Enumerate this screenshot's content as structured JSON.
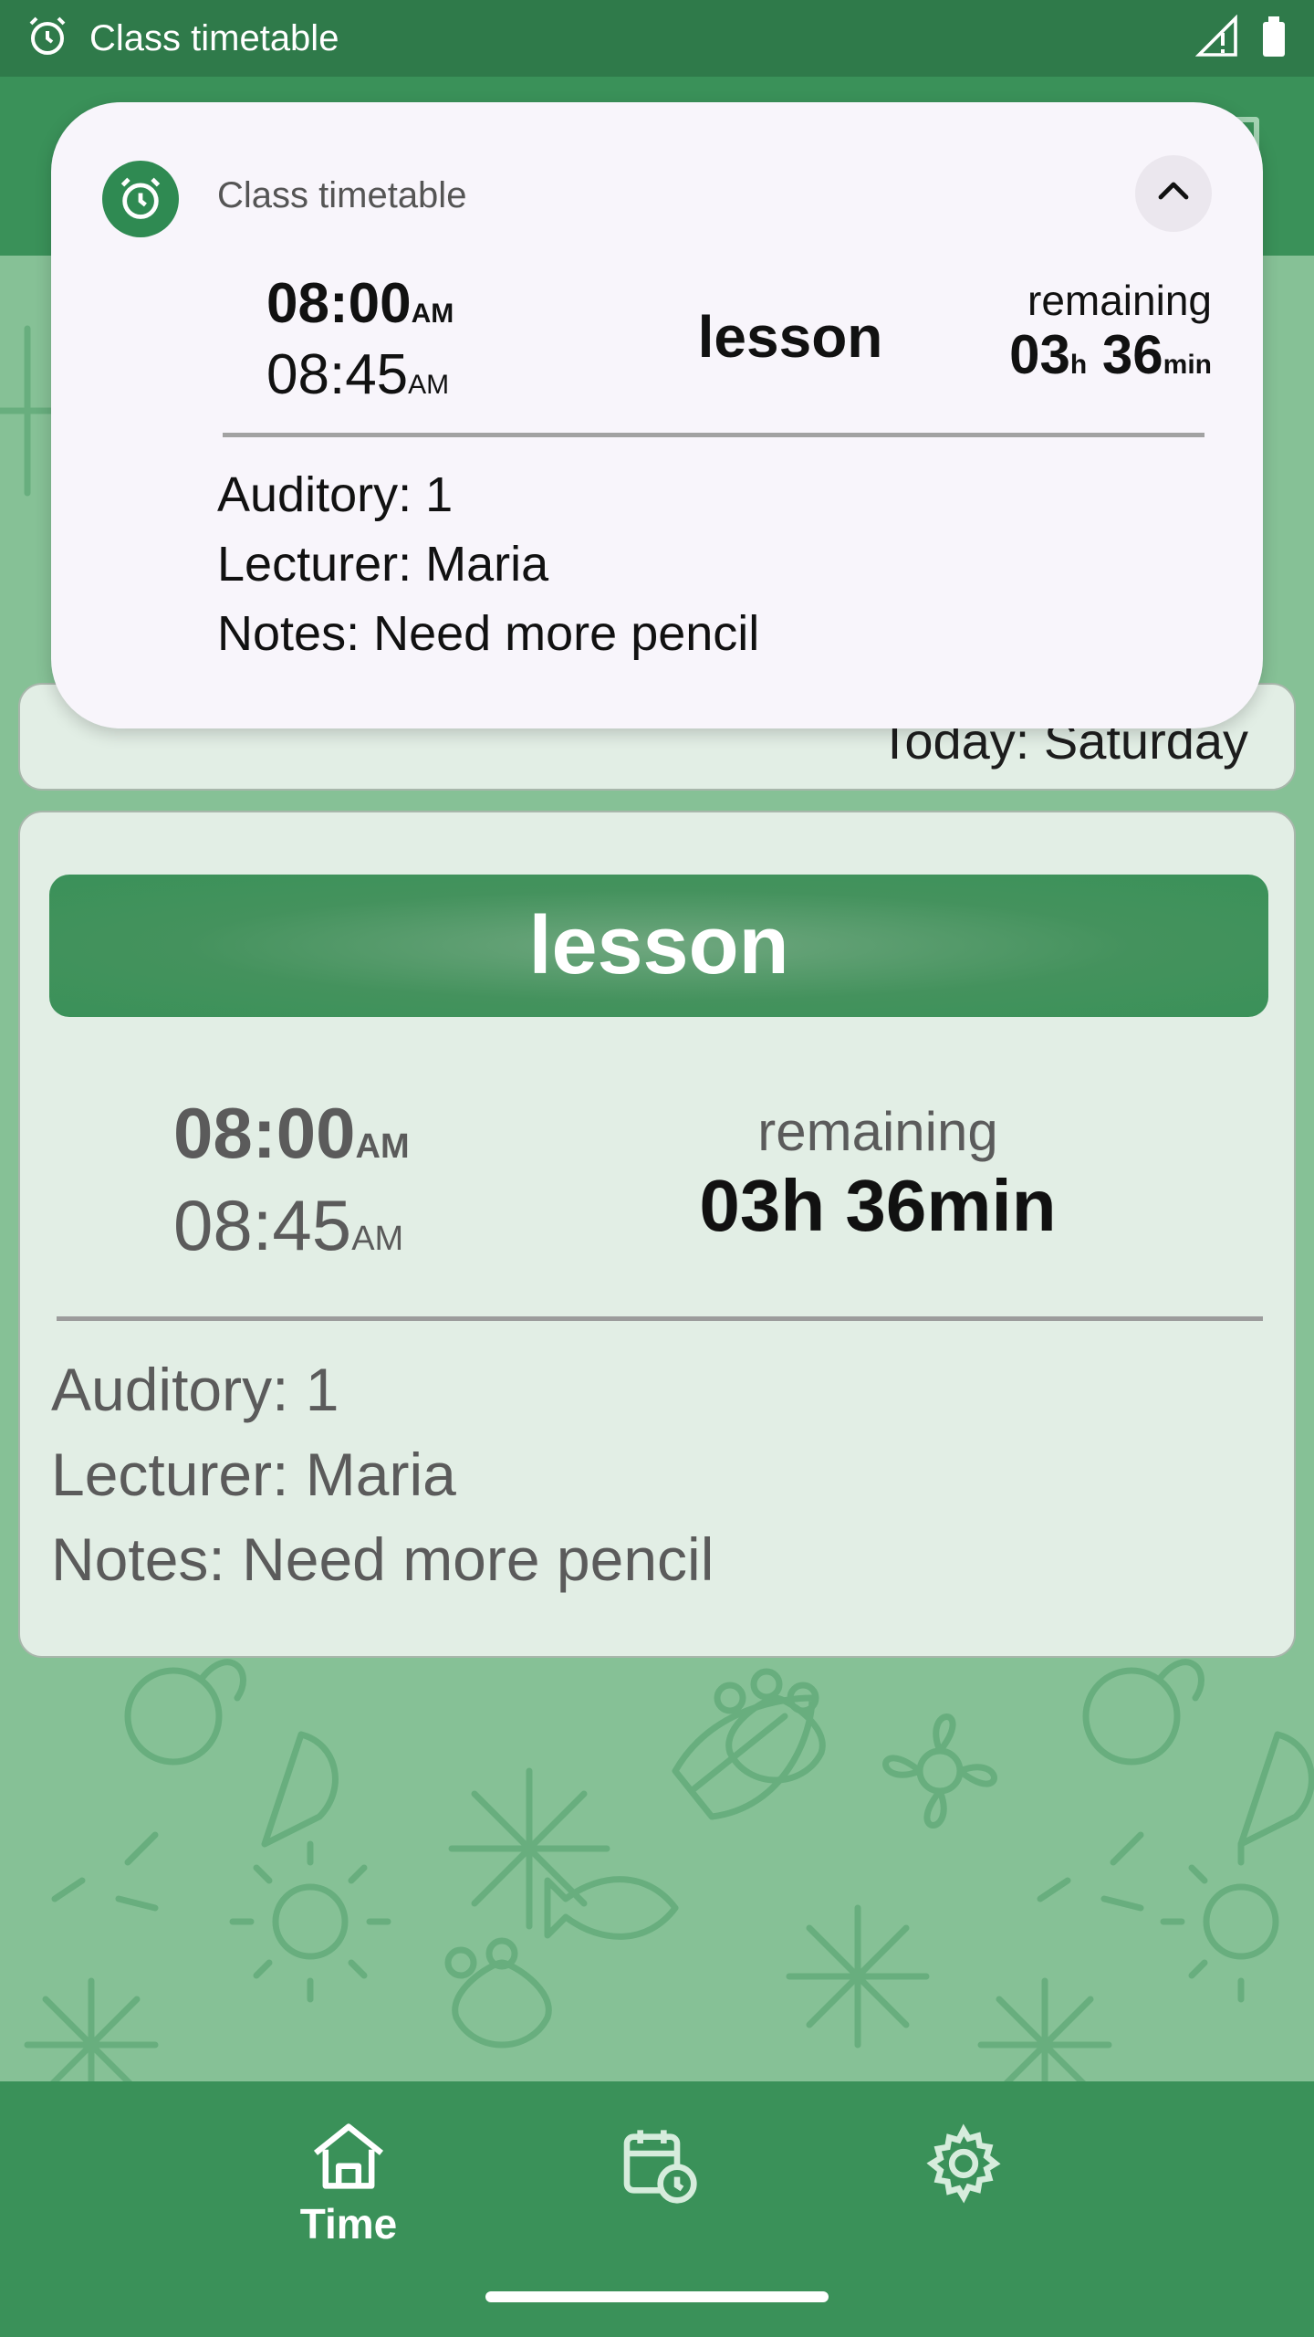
{
  "status_bar": {
    "app_title": "Class timetable",
    "icons": [
      "alarm-icon",
      "signal-icon",
      "battery-icon"
    ]
  },
  "notification": {
    "app_name": "Class timetable",
    "start_time": "08:00",
    "start_ampm": "AM",
    "end_time": "08:45",
    "end_ampm": "AM",
    "title": "lesson",
    "remaining_label": "remaining",
    "remaining_hours": "03",
    "remaining_hours_unit": "h",
    "remaining_minutes": "36",
    "remaining_minutes_unit": "min",
    "auditory": "Auditory: 1",
    "lecturer": "Lecturer: Maria",
    "notes": "Notes: Need more pencil"
  },
  "today": {
    "text": "Today: Saturday"
  },
  "lesson_card": {
    "title": "lesson",
    "start_time": "08:00",
    "start_ampm": "AM",
    "end_time": "08:45",
    "end_ampm": "AM",
    "remaining_label": "remaining",
    "remaining_value": "03h 36min",
    "auditory": "Auditory: 1",
    "lecturer": "Lecturer: Maria",
    "notes": "Notes: Need more pencil"
  },
  "bottom_nav": {
    "items": [
      {
        "label": "Time",
        "icon": "home-icon",
        "active": true
      },
      {
        "label": "",
        "icon": "calendar-clock-icon",
        "active": false
      },
      {
        "label": "",
        "icon": "gear-icon",
        "active": false
      }
    ]
  },
  "colors": {
    "primary": "#3a9159",
    "status_bar": "#2f7a4a",
    "background": "#86c196",
    "card": "#eaf2ec"
  }
}
